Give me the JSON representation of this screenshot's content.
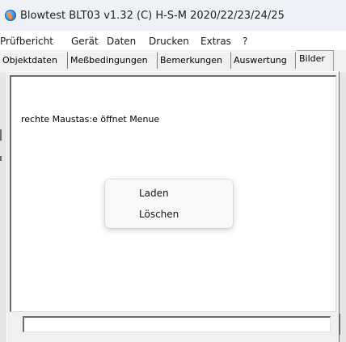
{
  "window": {
    "title": "Blowtest BLT03 v1.32 (C) H-S-M  2020/22/23/24/25"
  },
  "menubar": {
    "items": [
      "Prüfbericht",
      "Gerät",
      "Daten",
      "Drucken",
      "Extras",
      "?"
    ]
  },
  "tabs": [
    {
      "label": "Objektdaten",
      "active": false
    },
    {
      "label": "Meßbedingungen",
      "active": false
    },
    {
      "label": "Bemerkungen",
      "active": false
    },
    {
      "label": "Auswertung",
      "active": false
    },
    {
      "label": "Bilder",
      "active": true
    }
  ],
  "images_tab": {
    "hint": "rechte Maustas:e öffnet Menue",
    "bottom_field_value": ""
  },
  "context_menu": {
    "items": [
      "Laden",
      "Löschen"
    ]
  },
  "colors": {
    "titlebar_bg": "#eef1f6",
    "menubar_bg": "#ffffff",
    "tab_bg": "#f0f0f0",
    "workarea_bg": "#ffffff"
  }
}
